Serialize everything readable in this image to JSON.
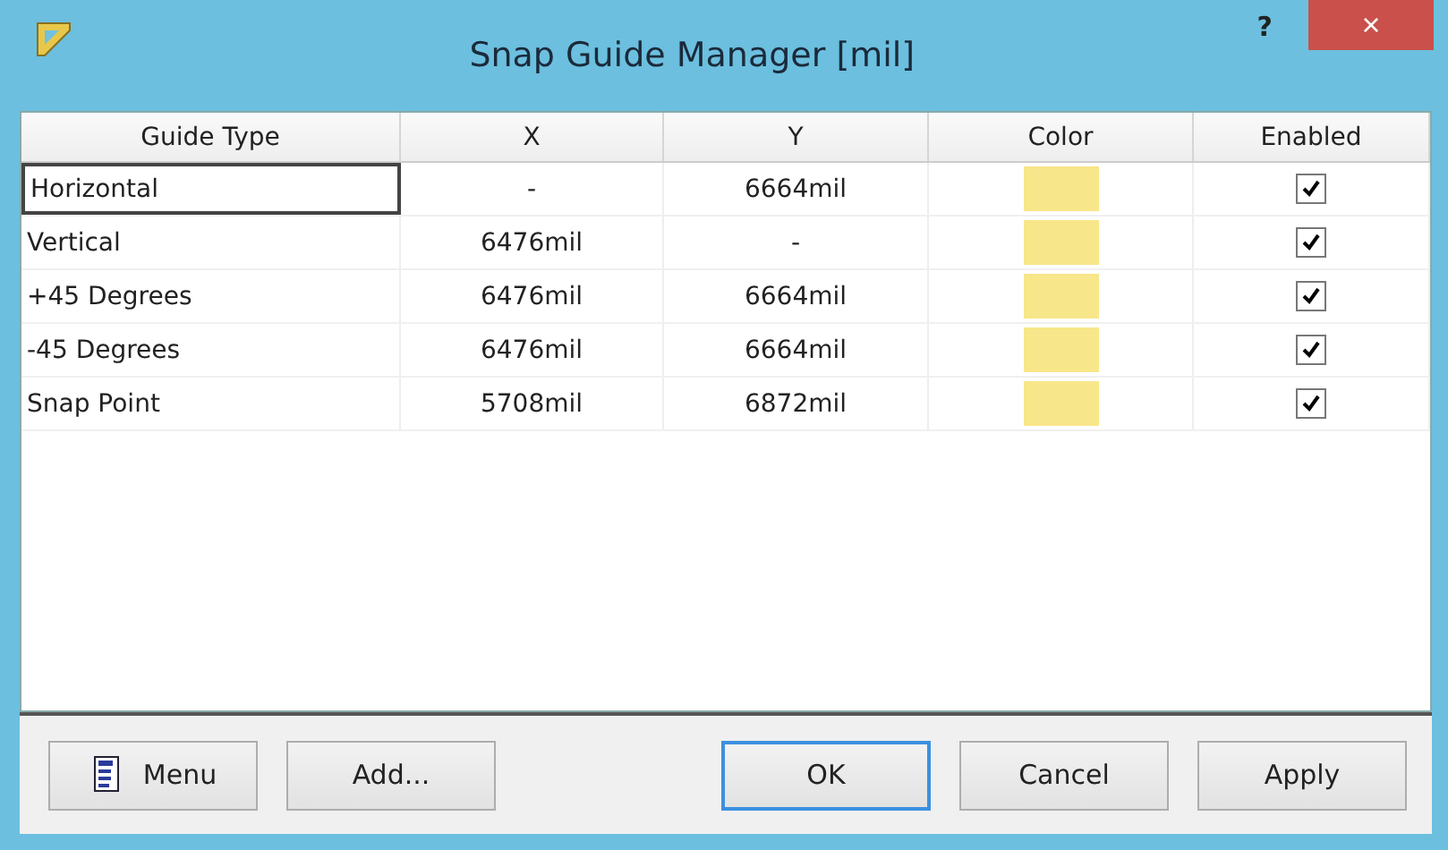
{
  "window": {
    "title": "Snap Guide Manager [mil]",
    "help": "?",
    "close": "×"
  },
  "table": {
    "columns": [
      "Guide Type",
      "X",
      "Y",
      "Color",
      "Enabled"
    ],
    "rows": [
      {
        "type": "Horizontal",
        "x": "-",
        "y": "6664mil",
        "color": "#f8e68a",
        "enabled": true,
        "selected": true
      },
      {
        "type": "Vertical",
        "x": "6476mil",
        "y": "-",
        "color": "#f8e68a",
        "enabled": true,
        "selected": false
      },
      {
        "type": "+45 Degrees",
        "x": "6476mil",
        "y": "6664mil",
        "color": "#f8e68a",
        "enabled": true,
        "selected": false
      },
      {
        "type": "-45 Degrees",
        "x": "6476mil",
        "y": "6664mil",
        "color": "#f8e68a",
        "enabled": true,
        "selected": false
      },
      {
        "type": "Snap Point",
        "x": "5708mil",
        "y": "6872mil",
        "color": "#f8e68a",
        "enabled": true,
        "selected": false
      }
    ]
  },
  "buttons": [
    {
      "label": "Menu",
      "kind": "menu",
      "default": false
    },
    {
      "label": "Add...",
      "kind": "plain",
      "default": false
    },
    {
      "label": "OK",
      "kind": "plain",
      "default": true
    },
    {
      "label": "Cancel",
      "kind": "plain",
      "default": false
    },
    {
      "label": "Apply",
      "kind": "plain",
      "default": false
    }
  ]
}
